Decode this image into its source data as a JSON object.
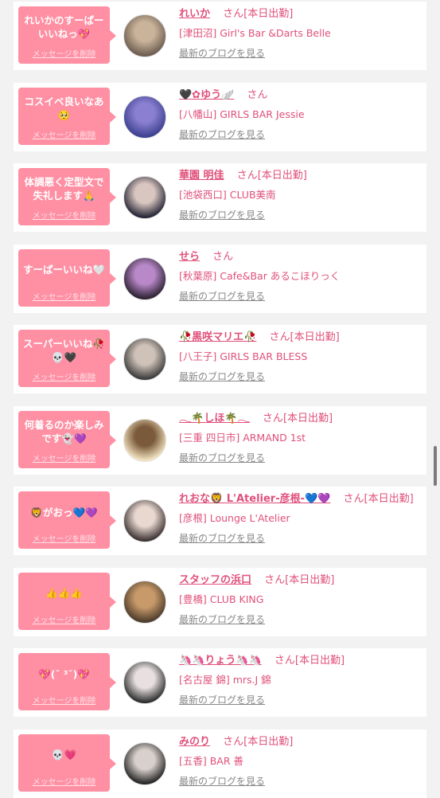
{
  "delete_label": "メッセージを削除",
  "blog_label": "最新のブログを見る",
  "san": "さん",
  "entries": [
    {
      "message": "れいかのすーぱーいいねっ💖",
      "name": "れいか",
      "status": "[本日出勤]",
      "shop": "[津田沼] Girl's Bar &Darts Belle",
      "avatar_colors": [
        "#6b5a4e",
        "#c9b49a"
      ]
    },
    {
      "message": "コスイベ良いなあ🥺",
      "name": "🖤✿ゆう🪽",
      "status": "",
      "shop": "[八幡山] GIRLS BAR Jessie",
      "avatar_colors": [
        "#3b3f8f",
        "#8a7fd0"
      ]
    },
    {
      "message": "体調悪く定型文で失礼します🙏",
      "name": "華園 明佳",
      "status": "[本日出勤]",
      "shop": "[池袋西口] CLUB美南",
      "avatar_colors": [
        "#222233",
        "#d9c6c0"
      ]
    },
    {
      "message": "すーぱーいいね🤍",
      "name": "せら",
      "status": "",
      "shop": "[秋葉原] Cafe&Bar あるこほりっく",
      "avatar_colors": [
        "#2a2030",
        "#b888c8"
      ]
    },
    {
      "message": "スーパーいいね🥀💀🖤",
      "name": "🥀黒咲マリエ🥀",
      "status": "[本日出勤]",
      "shop": "[八王子] GIRLS BAR BLESS",
      "avatar_colors": [
        "#3a3a3a",
        "#cfc2b8"
      ]
    },
    {
      "message": "何着るのか楽しみです👻💜",
      "name": "𓂃🌴しほ🌴𓂃",
      "status": "[本日出勤]",
      "shop": "[三重 四日市] ARMAND 1st",
      "avatar_colors": [
        "#f5e6c4",
        "#7a5a3a"
      ]
    },
    {
      "message": "🦁がおっ💙💜",
      "name": "れおな🦁 L'Atelier-彦根-💙💜",
      "status": "[本日出勤]",
      "shop": "[彦根] Lounge L'Atelier",
      "avatar_colors": [
        "#3a3030",
        "#e8d8d0"
      ]
    },
    {
      "message": "👍👍👍",
      "name": "スタッフの浜口",
      "status": "[本日出勤]",
      "shop": "[豊橋] CLUB KING",
      "avatar_colors": [
        "#4a3a2a",
        "#c89a6a"
      ]
    },
    {
      "message": "💖(˘ ³˘)💖",
      "name": "🦄🦄りょう🦄🦄",
      "status": "[本日出勤]",
      "shop": "[名古屋 錦] mrs.J 錦",
      "avatar_colors": [
        "#2a2a2a",
        "#e8e0e0"
      ]
    },
    {
      "message": "💀💗",
      "name": "みのり",
      "status": "[本日出勤]",
      "shop": "[五香] BAR 善",
      "avatar_colors": [
        "#222222",
        "#d8d0cc"
      ]
    }
  ]
}
